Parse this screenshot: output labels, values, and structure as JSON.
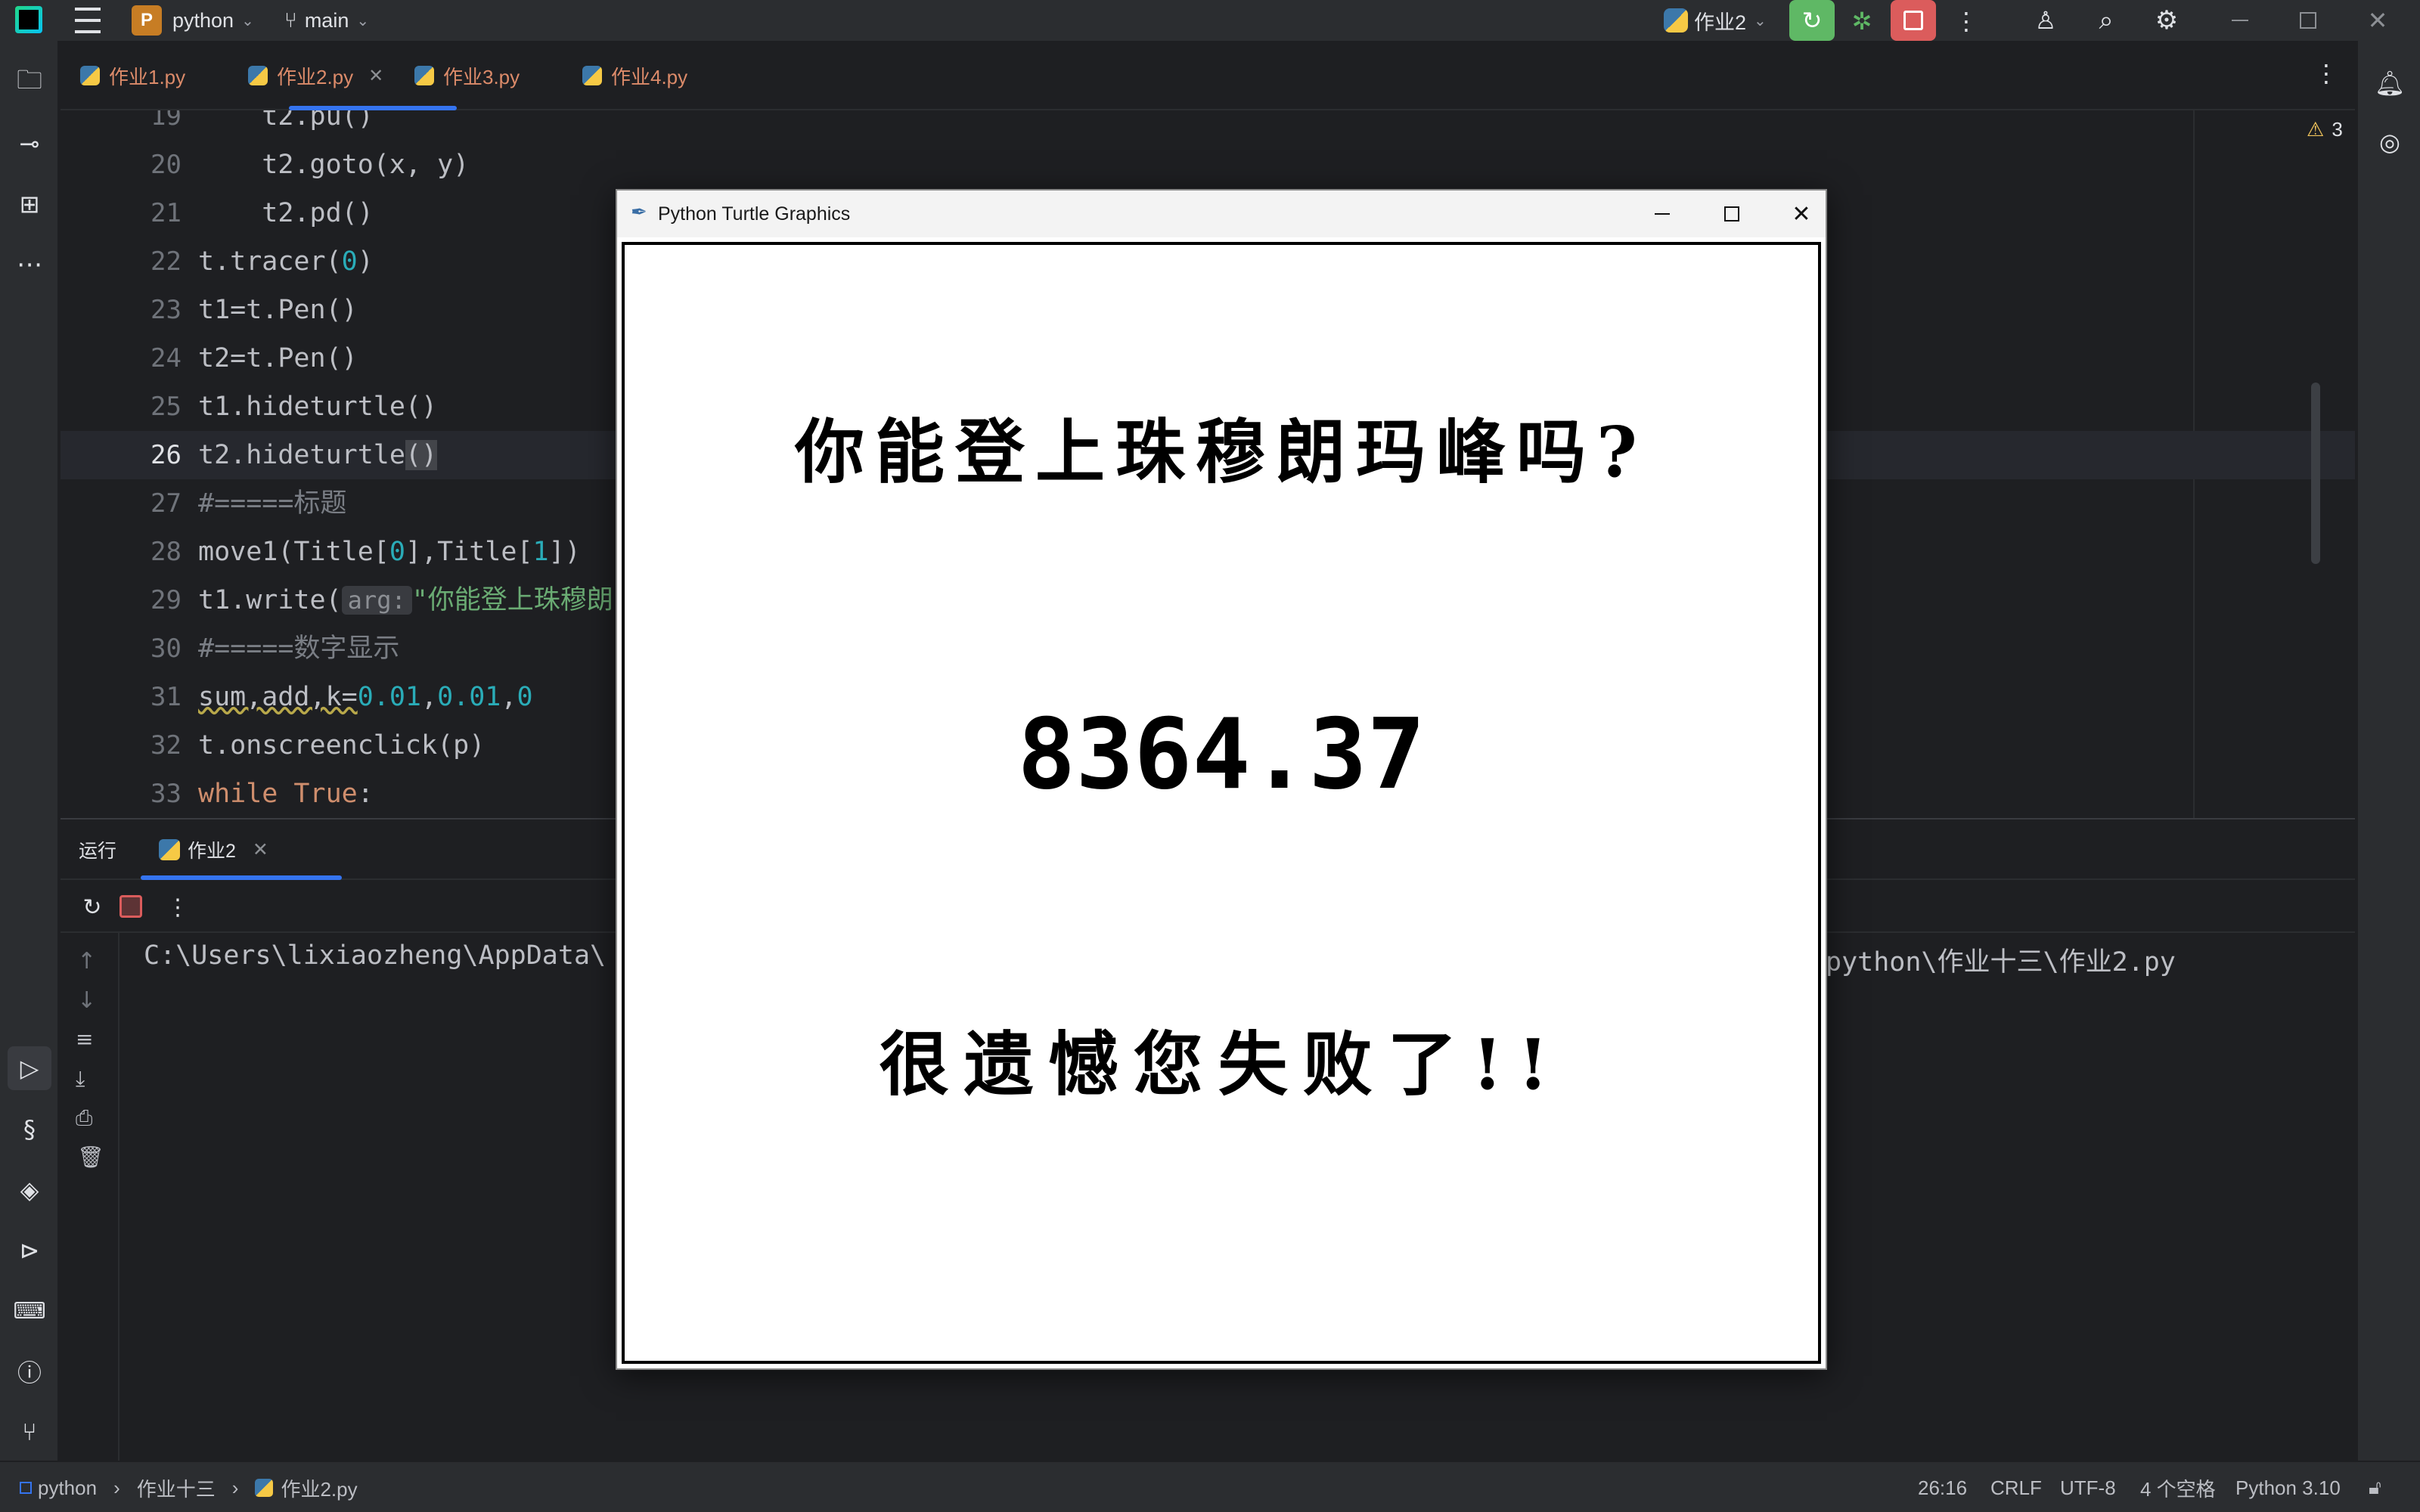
{
  "titlebar": {
    "project_badge": "P",
    "project_name": "python",
    "branch": "main",
    "run_config": "作业2"
  },
  "tabs": [
    {
      "label": "作业1.py"
    },
    {
      "label": "作业2.py"
    },
    {
      "label": "作业3.py"
    },
    {
      "label": "作业4.py"
    }
  ],
  "editor": {
    "warning_count": "3",
    "lines": [
      {
        "n": "19",
        "text": "    t2.pu()"
      },
      {
        "n": "20",
        "text": "    t2.goto(x, y)"
      },
      {
        "n": "21",
        "text": "    t2.pd()"
      },
      {
        "n": "22",
        "a": "t.tracer(",
        "b": "0",
        "c": ")"
      },
      {
        "n": "23",
        "text": "t1=t.Pen()"
      },
      {
        "n": "24",
        "text": "t2=t.Pen()"
      },
      {
        "n": "25",
        "text": "t1.hideturtle()"
      },
      {
        "n": "26",
        "a": "t2.hideturtle",
        "b": "()"
      },
      {
        "n": "27",
        "text": "#=====标题"
      },
      {
        "n": "28",
        "a": "move1(Title[",
        "b": "0",
        "c": "],Title[",
        "d": "1",
        "e": "])"
      },
      {
        "n": "29",
        "a": "t1.write(",
        "hint": "arg:",
        "s": "\"你能登上珠穆朗"
      },
      {
        "n": "30",
        "text": "#=====数字显示"
      },
      {
        "n": "31",
        "a": "sum,add,k=",
        "b": "0.01",
        "c": ",",
        "d": "0.01",
        "e": ",",
        "f": "0"
      },
      {
        "n": "32",
        "text": "t.onscreenclick(p)"
      },
      {
        "n": "33",
        "a": "while True",
        "b": ":"
      }
    ]
  },
  "run": {
    "tab_run": "运行",
    "tab_config": "作业2",
    "console_left": "C:\\Users\\lixiaozheng\\AppData\\",
    "console_right": "python\\作业十三\\作业2.py"
  },
  "statusbar": {
    "crumb1": "python",
    "crumb2": "作业十三",
    "crumb3": "作业2.py",
    "position": "26:16",
    "line_sep": "CRLF",
    "encoding": "UTF-8",
    "indent": "4 个空格",
    "interpreter": "Python 3.10"
  },
  "turtle": {
    "window_title": "Python Turtle Graphics",
    "title_text": "你能登上珠穆朗玛峰吗?",
    "number": "8364.37",
    "message": "很遗憾您失败了!!"
  },
  "colors": {
    "accent": "#3574f0",
    "run_green": "#5fb865",
    "stop_red": "#db5c5c"
  }
}
